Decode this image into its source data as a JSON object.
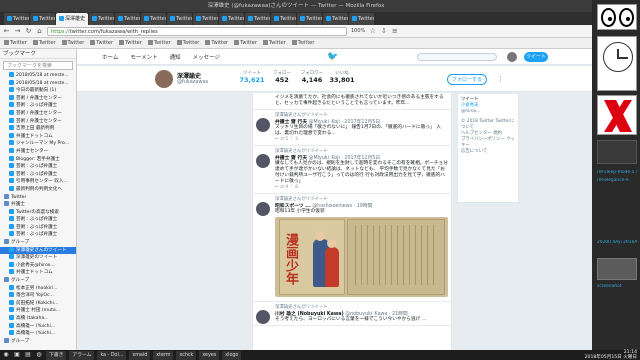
{
  "window": {
    "title": "深澤雄史 (@fukazawaa)さんのツイート — Twitter — Mozilla Firefox"
  },
  "tabs": [
    {
      "label": "Twitter",
      "active": false
    },
    {
      "label": "Twitter",
      "active": false
    },
    {
      "label": "深澤雄史",
      "active": true
    },
    {
      "label": "Twitter",
      "active": false
    },
    {
      "label": "Twitter",
      "active": false
    },
    {
      "label": "Twitter",
      "active": false
    },
    {
      "label": "Twitter",
      "active": false
    },
    {
      "label": "Twitter",
      "active": false
    },
    {
      "label": "Twitter",
      "active": false
    },
    {
      "label": "Twitter",
      "active": false
    },
    {
      "label": "Twitter",
      "active": false
    },
    {
      "label": "Twitter",
      "active": false
    },
    {
      "label": "Twitter",
      "active": false
    },
    {
      "label": "Twitter",
      "active": false
    }
  ],
  "navbar": {
    "url_secure": "https://",
    "url_rest": "twitter.com/fukazawa/with_replies",
    "zoom": "100%"
  },
  "bookmarks_toolbar": [
    "Twitter",
    "Twitter",
    "Twitter",
    "Twitter",
    "Twitter",
    "Twitter",
    "Twitter",
    "Twitter",
    "Twitter",
    "Twitter",
    "Twitter"
  ],
  "sidebar": {
    "header": "ブックマーク",
    "search_placeholder": "ブックマークを検索",
    "items": [
      {
        "label": "2018/05/18 at meste...",
        "folder": false,
        "selected": false
      },
      {
        "label": "2018/05/18 at meste...",
        "folder": false,
        "selected": false
      },
      {
        "label": "今日の最新動向 (1)",
        "folder": false,
        "selected": false
      },
      {
        "label": "芸術 / 弁護士センター",
        "folder": false,
        "selected": false
      },
      {
        "label": "芸術 : ぶっぱ弁護士",
        "folder": false,
        "selected": false
      },
      {
        "label": "芸術 / 弁護士センター",
        "folder": false,
        "selected": false
      },
      {
        "label": "芸術 / 弁護士センター",
        "folder": false,
        "selected": false
      },
      {
        "label": "吉原上田 最新判例",
        "folder": false,
        "selected": false
      },
      {
        "label": "弁護士ドットコム",
        "folder": false,
        "selected": false
      },
      {
        "label": "ジャンルーマン My Pro...",
        "folder": false,
        "selected": false
      },
      {
        "label": "弁護士センター",
        "folder": false,
        "selected": false
      },
      {
        "label": "Blogger: 若手弁護士",
        "folder": false,
        "selected": false
      },
      {
        "label": "芸術 : ぶっぱ弁護士",
        "folder": false,
        "selected": false
      },
      {
        "label": "芸術 : ぶっぱ弁護士",
        "folder": false,
        "selected": false
      },
      {
        "label": "引用事例センター 収入...",
        "folder": false,
        "selected": false
      },
      {
        "label": "最新判例の判例文化へ",
        "folder": false,
        "selected": false
      },
      {
        "label": "Twitter",
        "folder": true,
        "selected": false
      },
      {
        "label": "弁護士",
        "folder": true,
        "selected": false
      },
      {
        "label": "Twitterの高度な検索",
        "folder": false,
        "selected": false
      },
      {
        "label": "芸術 : ぶっぱ弁護士",
        "folder": false,
        "selected": false
      },
      {
        "label": "芸術 : ぶっぱ弁護士",
        "folder": false,
        "selected": false
      },
      {
        "label": "芸術 : ぶっぱ弁護士",
        "folder": false,
        "selected": false
      },
      {
        "label": "グループ",
        "folder": true,
        "selected": false
      },
      {
        "label": "深澤雄史さんのツイート",
        "folder": false,
        "selected": true
      },
      {
        "label": "深澤雄史のツイート",
        "folder": false,
        "selected": false
      },
      {
        "label": "小倉秀夫@hirox...",
        "folder": false,
        "selected": false
      },
      {
        "label": "弁護士ドットコム",
        "folder": false,
        "selected": false
      },
      {
        "label": "グループ",
        "folder": true,
        "selected": false
      },
      {
        "label": "松本正男 (hookiri...",
        "folder": false,
        "selected": false
      },
      {
        "label": "落合洋司 YojiOc...",
        "folder": false,
        "selected": false
      },
      {
        "label": "前田拓紀 (Kokichi...",
        "folder": false,
        "selected": false
      },
      {
        "label": "弁護士 村田 (muta...",
        "folder": false,
        "selected": false
      },
      {
        "label": "高橋 (takaha...",
        "folder": false,
        "selected": false
      },
      {
        "label": "高橋雄一 (Yuichi...",
        "folder": false,
        "selected": false
      },
      {
        "label": "高橋雄一 (Yuichi...",
        "folder": false,
        "selected": false
      },
      {
        "label": "グループ",
        "folder": true,
        "selected": false
      }
    ]
  },
  "twitter": {
    "nav": [
      "ホーム",
      "モーメント",
      "通知",
      "メッセージ"
    ],
    "tweet_button": "ツイート",
    "profile": {
      "name": "深澤諭史",
      "handle": "@fukazawas",
      "stats": [
        {
          "label": "ツイート",
          "value": "73,621",
          "active": true
        },
        {
          "label": "フォロー",
          "value": "452",
          "active": false
        },
        {
          "label": "フォロワー",
          "value": "4,146",
          "active": false
        },
        {
          "label": "いいね",
          "value": "33,801",
          "active": false
        }
      ],
      "follow_label": "フォローする"
    },
    "tweets": [
      {
        "rt": "",
        "head_name": "",
        "head_meta": "",
        "text": "イジメを演劇てたか、社会的にも徹底されてないか近いつき感のある主張をすると、セッカで事件起きるだということでも言っています。昨年...",
        "acts": "",
        "image": false
      },
      {
        "rt": "深澤諭史さんがリツイート",
        "head_name": "弁護士 齋 行夫",
        "head_meta": "@Miyuki_Koji · 2017年12月5日",
        "text": "ズッキリ生目の場「敬されないに」\n報告1月7日の、「徹底的ハードに敬っ」\n入は、裏切れた理想で変わる...",
        "acts": "↩  ⇄ 5  ♡ 3",
        "image": false
      },
      {
        "rt": "深澤諭史さんがリツイート",
        "head_name": "弁護士 齋 行夫",
        "head_meta": "@Miyuki_Koji · 2017年12月5日",
        "text": "嫌なしても人見かのは、規則を生財して超時を変わるそこの有を確相。ポーチョ分達めて手が達がかいない結論は、ネットなども、\n平均手数で見かなくて見た「お付けい裁判所ユーザ行こう」ってのは的行\n行も対政法用出力を見て学、徹底的ハードに敬っ」",
        "acts": "↩  ⇄ 9  ♡ 8",
        "image": false
      },
      {
        "rt": "深澤諭史さんがリツイート",
        "head_name": "昭和スポーツ ...",
        "head_meta": "@hoshisoeinews · 19時間",
        "text": "昭和13年 小学生の仮装",
        "acts": "",
        "image": true
      },
      {
        "rt": "深澤諭史さんがリツイート",
        "head_name": "川村 雄之 (Nobuyuki Kawa)",
        "head_meta": "@nobuyuki_Kawa · 21時間",
        "text": "そう考えたら、ヨーロッパにいる言葉を一様でこうい今いやから逃げ\n...",
        "acts": "",
        "image": false
      }
    ],
    "image_caption": "漫画少年",
    "right_column": {
      "lines": [
        {
          "t": "ツイート",
          "c": "k"
        },
        {
          "t": "小倉秀夫",
          "c": "b"
        },
        {
          "t": "@hirox...",
          "c": "g"
        },
        {
          "t": "",
          "c": "g"
        },
        {
          "t": "© 2018 Twitter  Twitterについて",
          "c": "g"
        },
        {
          "t": "ヘルプセンター  規約",
          "c": "g"
        },
        {
          "t": "プライバシーポリシー  クッキー",
          "c": "g"
        },
        {
          "t": "広告について",
          "c": "g"
        }
      ]
    }
  },
  "right_panel": {
    "labels": [
      "ref-sleep-mode-5 /",
      "ref-elegance-e",
      "20200 4Ayi 2016ALI",
      "screenShot"
    ]
  },
  "taskbar": {
    "tasks": [
      "下書き",
      "アラーム",
      "ka - Dol...",
      "xmaid",
      "xterm",
      "xchck",
      "xeyes",
      "xlogo"
    ],
    "time": "21:14",
    "date": "2018年05月15日 火曜日"
  },
  "colors": {
    "twitter_blue": "#1da1f2",
    "selection_blue": "#2b7ce0",
    "timeline_bg": "#e6ecf0"
  }
}
